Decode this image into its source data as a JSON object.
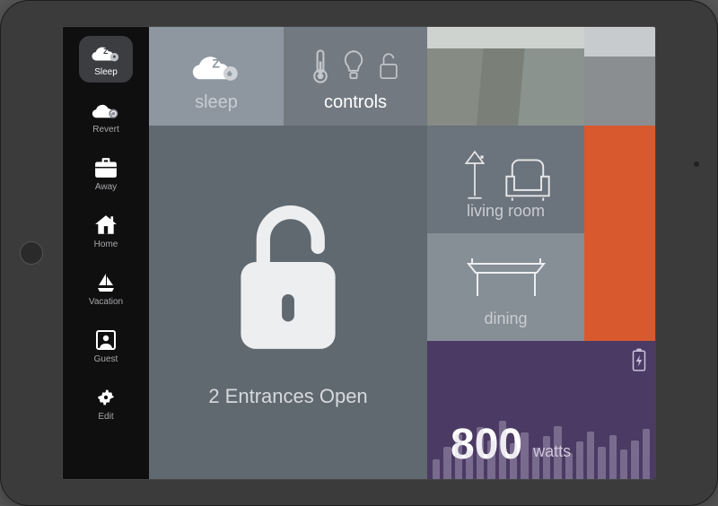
{
  "app": "smart-home-dashboard",
  "sidebar": {
    "items": [
      {
        "label": "Sleep",
        "icon": "cloud-sleep-icon"
      },
      {
        "label": "Revert",
        "icon": "cloud-revert-icon"
      },
      {
        "label": "Away",
        "icon": "briefcase-icon"
      },
      {
        "label": "Home",
        "icon": "house-icon"
      },
      {
        "label": "Vacation",
        "icon": "sailboat-icon"
      },
      {
        "label": "Guest",
        "icon": "user-square-icon"
      },
      {
        "label": "Edit",
        "icon": "gear-icon"
      }
    ],
    "active_index": 0
  },
  "tiles": {
    "sleep": {
      "label": "sleep",
      "icon": "cloud-sleep-icon"
    },
    "controls": {
      "label": "controls",
      "icons": [
        "thermometer-icon",
        "lightbulb-icon",
        "lock-open-icon"
      ]
    },
    "cameras": [
      "driveway-camera",
      "side-camera"
    ],
    "lock": {
      "status_text": "2 Entrances Open",
      "locked": false,
      "icon": "padlock-open-icon"
    },
    "rooms": [
      {
        "label": "living room",
        "icons": [
          "floor-lamp-icon",
          "armchair-icon"
        ]
      },
      {
        "label": "dining",
        "icons": [
          "table-icon"
        ]
      }
    ],
    "orange_scene": {
      "color": "#d9592e"
    },
    "energy": {
      "value": "800",
      "unit": "watts",
      "icon": "battery-charging-icon"
    }
  },
  "colors": {
    "sidebar_bg": "#0f0f10",
    "accent_orange": "#d9592e",
    "energy_bg": "#4b3a63"
  }
}
